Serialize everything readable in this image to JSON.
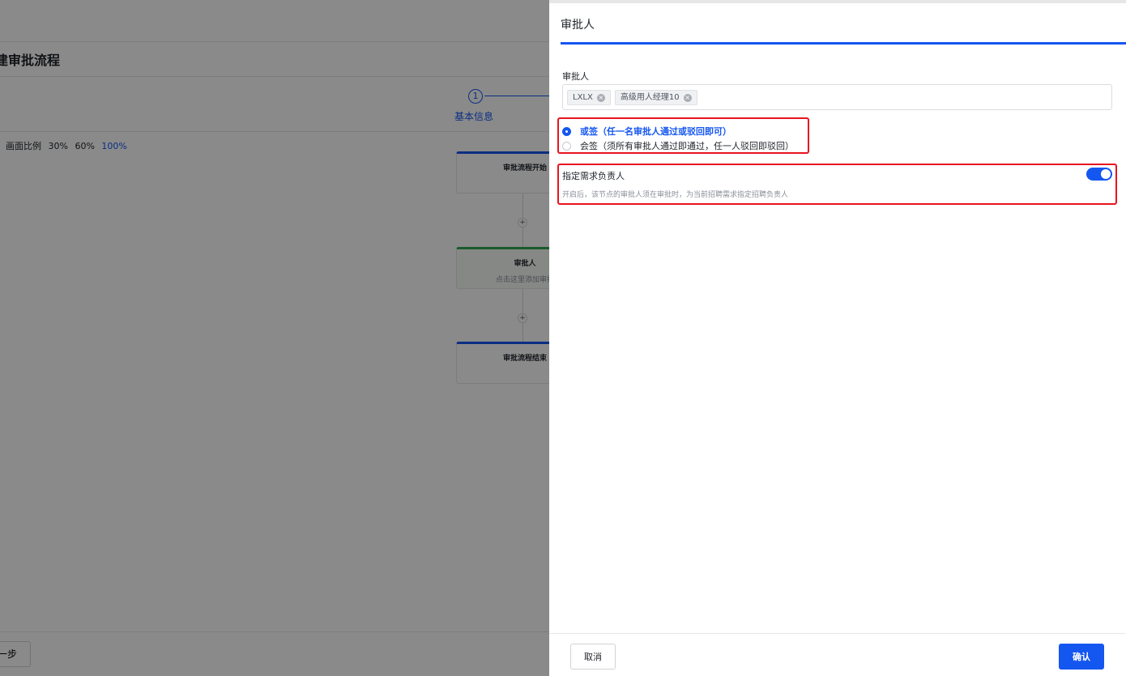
{
  "background": {
    "page_title": "建审批流程",
    "step": {
      "number": "1",
      "label": "基本信息"
    },
    "zoom": {
      "label": "画面比例",
      "options": [
        "30%",
        "60%",
        "100%"
      ],
      "active": "100%"
    },
    "flow": {
      "start_title": "审批流程开始",
      "plus": "+",
      "approver_title": "审批人",
      "approver_hint": "点击这里添加审批",
      "end_title": "审批流程结束"
    },
    "footer": {
      "prev_button": "一步"
    }
  },
  "drawer": {
    "title": "审批人",
    "approver_field": {
      "label": "审批人",
      "tags": [
        "LXLX",
        "高级用人经理10"
      ]
    },
    "sign_mode": {
      "options": [
        {
          "label": "或签（任一名审批人通过或驳回即可）",
          "checked": true
        },
        {
          "label": "会签（须所有审批人通过即通过，任一人驳回即驳回）",
          "checked": false
        }
      ]
    },
    "assign_owner": {
      "title": "指定需求负责人",
      "enabled": true,
      "description": "开启后，该节点的审批人须在审批时，为当前招聘需求指定招聘负责人"
    },
    "footer": {
      "cancel": "取消",
      "confirm": "确认"
    }
  },
  "colors": {
    "accent": "#1456f0",
    "highlight_box": "#e8141f",
    "approver_node": "#2fa84f"
  }
}
